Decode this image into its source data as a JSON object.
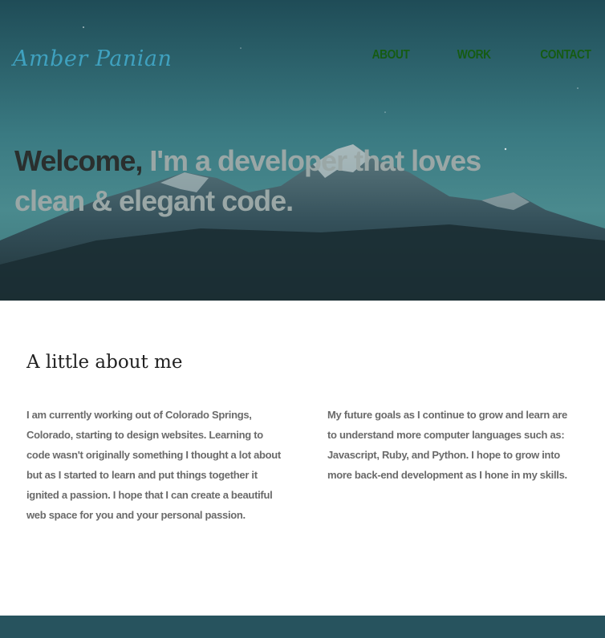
{
  "header": {
    "logo_text": "Amber Panian",
    "nav": [
      {
        "label": "ABOUT"
      },
      {
        "label": "WORK"
      },
      {
        "label": "CONTACT"
      }
    ]
  },
  "hero": {
    "welcome": "Welcome, ",
    "tagline": "I'm a developer that loves clean & elegant code."
  },
  "about": {
    "heading": "A little about me",
    "left_paragraph": "I am currently working out of Colorado Springs, Colorado, starting to design websites. Learning to code wasn't originally something I thought a lot about but as I started to learn and put things together it ignited a passion. I hope that I can create a beautiful web space for you and your personal passion.",
    "right_paragraph": "My future goals as I continue to grow and learn are to understand more computer languages such as: Javascript, Ruby, and Python. I hope to grow into more back-end development as I hone in my skills."
  },
  "colors": {
    "logo": "#3fa1bf",
    "nav": "#155b12",
    "footer": "#27535e"
  }
}
